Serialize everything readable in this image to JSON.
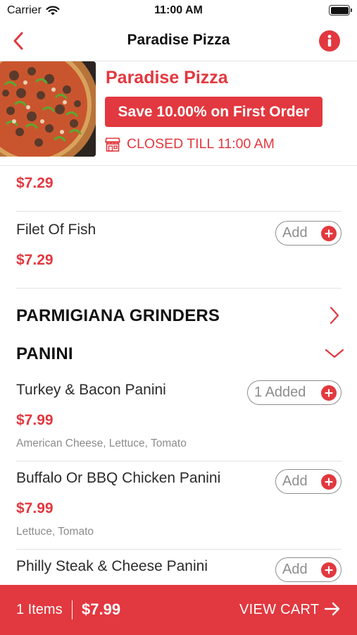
{
  "status": {
    "carrier": "Carrier",
    "time": "11:00 AM"
  },
  "nav": {
    "title": "Paradise Pizza"
  },
  "restaurant": {
    "name": "Paradise Pizza",
    "promo": "Save 10.00% on First Order",
    "status": "CLOSED TILL 11:00 AM"
  },
  "menu": {
    "partial_item_price": "$7.29",
    "items_before": [
      {
        "name": "Filet Of Fish",
        "price": "$7.29",
        "button": "Add"
      }
    ],
    "categories": [
      {
        "name": "PARMIGIANA GRINDERS",
        "state": "collapsed"
      },
      {
        "name": "PANINI",
        "state": "expanded"
      }
    ],
    "panini_items": [
      {
        "name": "Turkey & Bacon Panini",
        "price": "$7.99",
        "description": "American Cheese, Lettuce, Tomato",
        "button": "1 Added"
      },
      {
        "name": "Buffalo Or BBQ Chicken Panini",
        "price": "$7.99",
        "description": "Lettuce, Tomato",
        "button": "Add"
      },
      {
        "name": "Philly Steak & Cheese Panini",
        "button": "Add"
      }
    ]
  },
  "cart": {
    "count": "1 Items",
    "total": "$7.99",
    "action": "VIEW CART"
  },
  "colors": {
    "accent": "#e2383f",
    "muted": "#8d8d8d",
    "divider": "#e3e3e3"
  },
  "icons": {
    "back": "chevron-left-icon",
    "info": "info-icon",
    "store": "store-icon",
    "plus": "plus-icon",
    "expand": "chevron-right-icon",
    "collapse": "chevron-down-icon",
    "cart_arrow": "arrow-right-icon",
    "wifi": "wifi-icon",
    "battery": "battery-icon"
  }
}
